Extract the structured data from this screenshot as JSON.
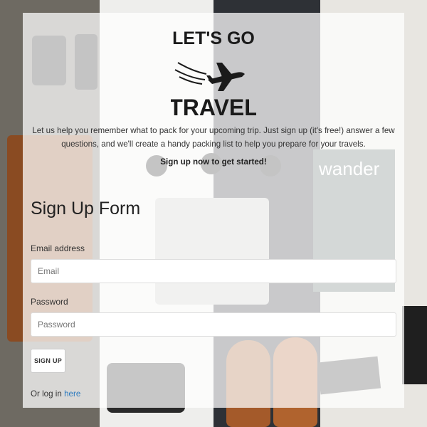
{
  "logo": {
    "line1": "LET'S GO",
    "line2": "TRAVEL"
  },
  "background": {
    "magazine_title": "wander"
  },
  "intro": "Let us help you remember what to pack for your upcoming trip. Just sign up (it's free!) answer a few questions, and we'll create a handy packing list to help you prepare for your travels.",
  "cta": "Sign up now to get started!",
  "form": {
    "title": "Sign Up Form",
    "email_label": "Email address",
    "email_placeholder": "Email",
    "password_label": "Password",
    "password_placeholder": "Password",
    "submit_label": "SIGN UP",
    "login_prefix": "Or log in",
    "login_link": "here"
  },
  "colors": {
    "link": "#2a7abf",
    "card": "rgba(255,255,255,0.74)"
  }
}
